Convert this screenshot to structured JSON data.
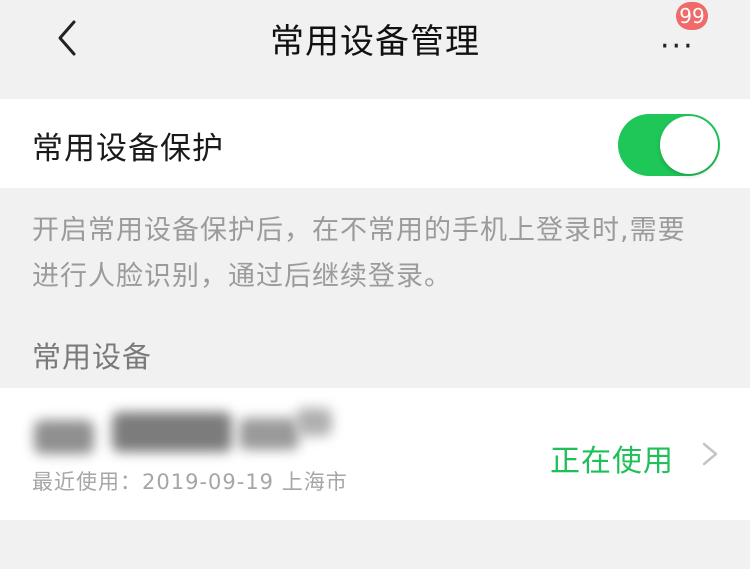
{
  "header": {
    "title": "常用设备管理",
    "badge_count": "99",
    "more_label": "···"
  },
  "protection": {
    "label": "常用设备保护",
    "enabled": true
  },
  "description": "开启常用设备保护后，在不常用的手机上登录时,需要进行人脸识别，通过后继续登录。",
  "devices_section": {
    "title": "常用设备",
    "items": [
      {
        "meta": "最近使用：2019-09-19 上海市",
        "status": "正在使用"
      }
    ]
  },
  "icons": {
    "back": "chevron-left-icon",
    "more": "more-icon",
    "row_chevron": "chevron-right-icon"
  },
  "colors": {
    "accent_green": "#1fc658",
    "badge_red": "#f06a6a"
  }
}
